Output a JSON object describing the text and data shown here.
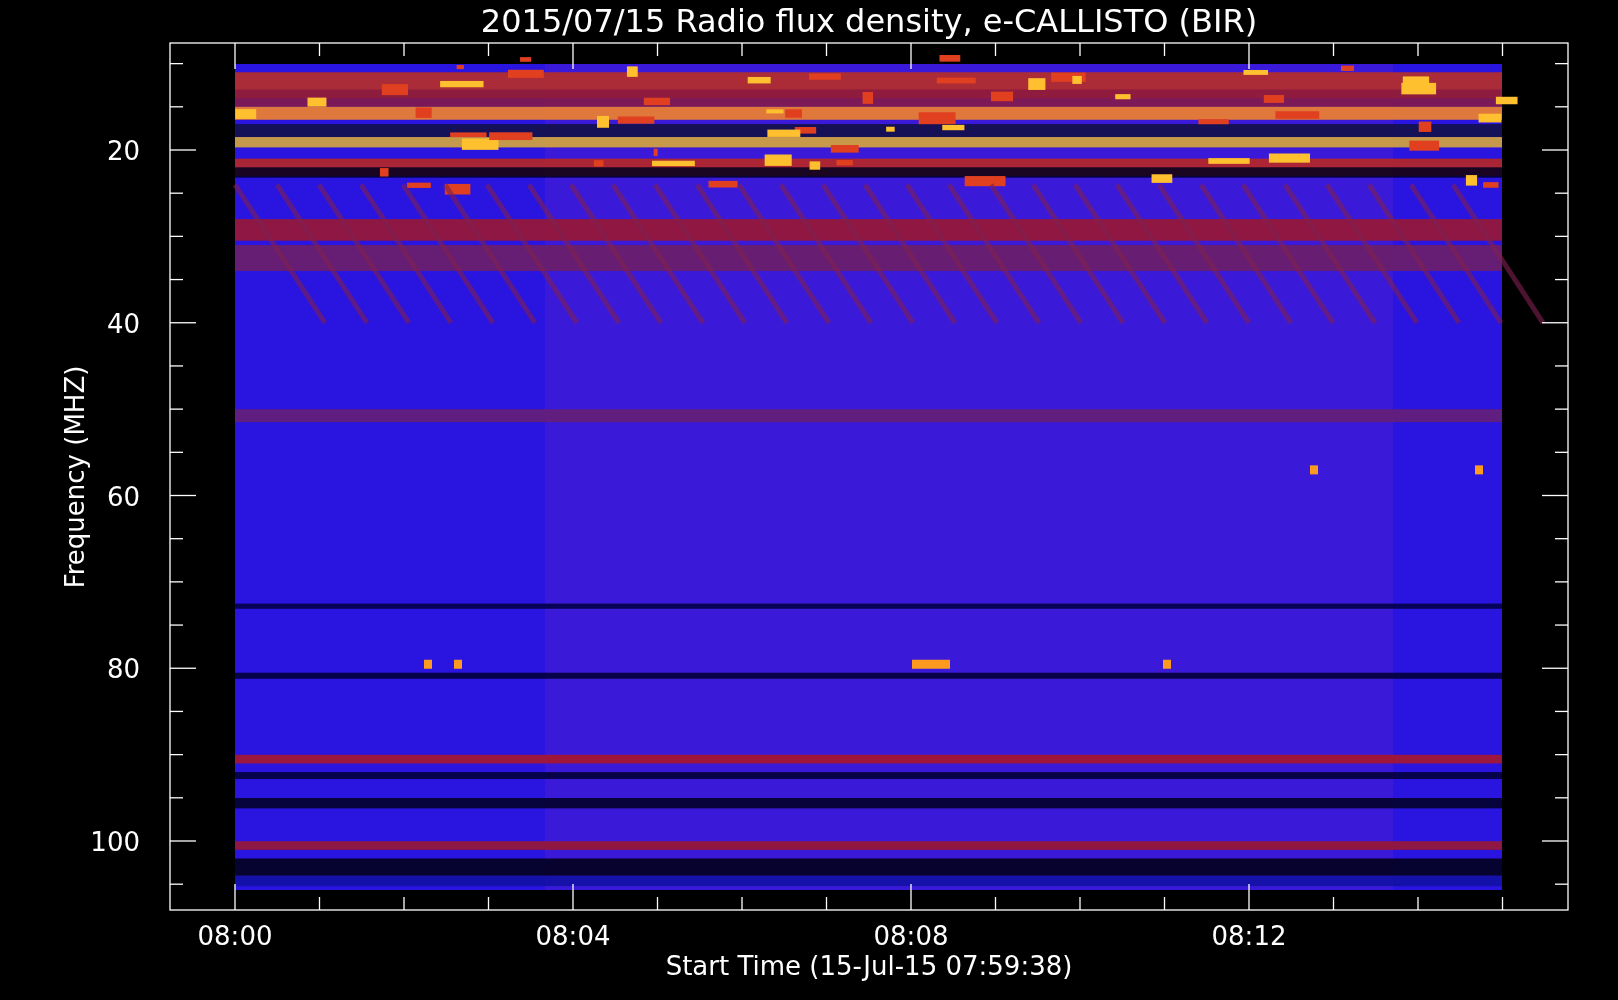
{
  "plot": {
    "title": "2015/07/15  Radio flux density, e-CALLISTO (BIR)",
    "ylabel": "Frequency (MHZ)",
    "xlabel": "Start Time (15-Jul-15 07:59:38)",
    "yticks": [
      "20",
      "40",
      "60",
      "80",
      "100"
    ],
    "xticks": [
      "08:00",
      "08:04",
      "08:08",
      "08:12"
    ]
  }
}
